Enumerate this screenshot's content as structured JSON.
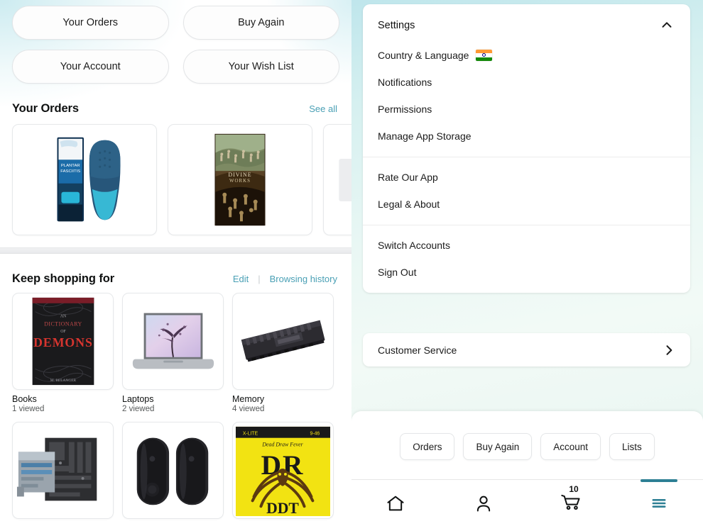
{
  "left_panel": {
    "quick_links": [
      {
        "label": "Your Orders"
      },
      {
        "label": "Buy Again"
      },
      {
        "label": "Your Account"
      },
      {
        "label": "Your Wish List"
      }
    ],
    "orders_section": {
      "title": "Your Orders",
      "see_all": "See all",
      "cards": [
        {
          "name": "shoe-insoles"
        },
        {
          "name": "book-cover-painting"
        },
        {
          "name": "partial-card"
        }
      ]
    },
    "keep_shopping": {
      "title": "Keep shopping for",
      "edit": "Edit",
      "separator": "|",
      "browsing_history": "Browsing history",
      "items": [
        {
          "label": "Books",
          "viewed": "1 viewed",
          "art": "book-demons"
        },
        {
          "label": "Laptops",
          "viewed": "2 viewed",
          "art": "laptop"
        },
        {
          "label": "Memory",
          "viewed": "4 viewed",
          "art": "ram-stick"
        },
        {
          "label": "",
          "viewed": "",
          "art": "motherboard"
        },
        {
          "label": "",
          "viewed": "",
          "art": "speakers"
        },
        {
          "label": "",
          "viewed": "",
          "art": "guitar-strings"
        }
      ]
    }
  },
  "right_panel": {
    "settings": {
      "header": "Settings",
      "collapse_icon": "chevron-up-icon",
      "group_1": [
        {
          "label": "Country & Language",
          "icon": "india-flag-icon"
        },
        {
          "label": "Notifications",
          "icon": ""
        },
        {
          "label": "Permissions",
          "icon": ""
        },
        {
          "label": "Manage App Storage",
          "icon": ""
        }
      ],
      "group_2": [
        {
          "label": "Rate Our App",
          "icon": ""
        },
        {
          "label": "Legal & About",
          "icon": ""
        }
      ],
      "group_3": [
        {
          "label": "Switch Accounts",
          "icon": ""
        },
        {
          "label": "Sign Out",
          "icon": ""
        }
      ]
    },
    "customer_service": {
      "label": "Customer Service",
      "chevron": "chevron-right-icon"
    },
    "bottom_sheet": {
      "quick_pills": [
        {
          "label": "Orders"
        },
        {
          "label": "Buy Again"
        },
        {
          "label": "Account"
        },
        {
          "label": "Lists"
        }
      ],
      "tabbar": [
        {
          "name": "home-icon",
          "active": false
        },
        {
          "name": "account-icon",
          "active": false
        },
        {
          "name": "cart-icon",
          "active": false,
          "badge": "10"
        },
        {
          "name": "menu-icon",
          "active": true
        }
      ]
    }
  },
  "colors": {
    "accent_teal": "#2d7f94",
    "link_teal": "#4aa0b5",
    "panel_bg_top": "#bfe6ec",
    "panel_bg_bottom": "#e6f4f1",
    "text_primary": "#0f1111",
    "text_secondary": "#565959"
  }
}
